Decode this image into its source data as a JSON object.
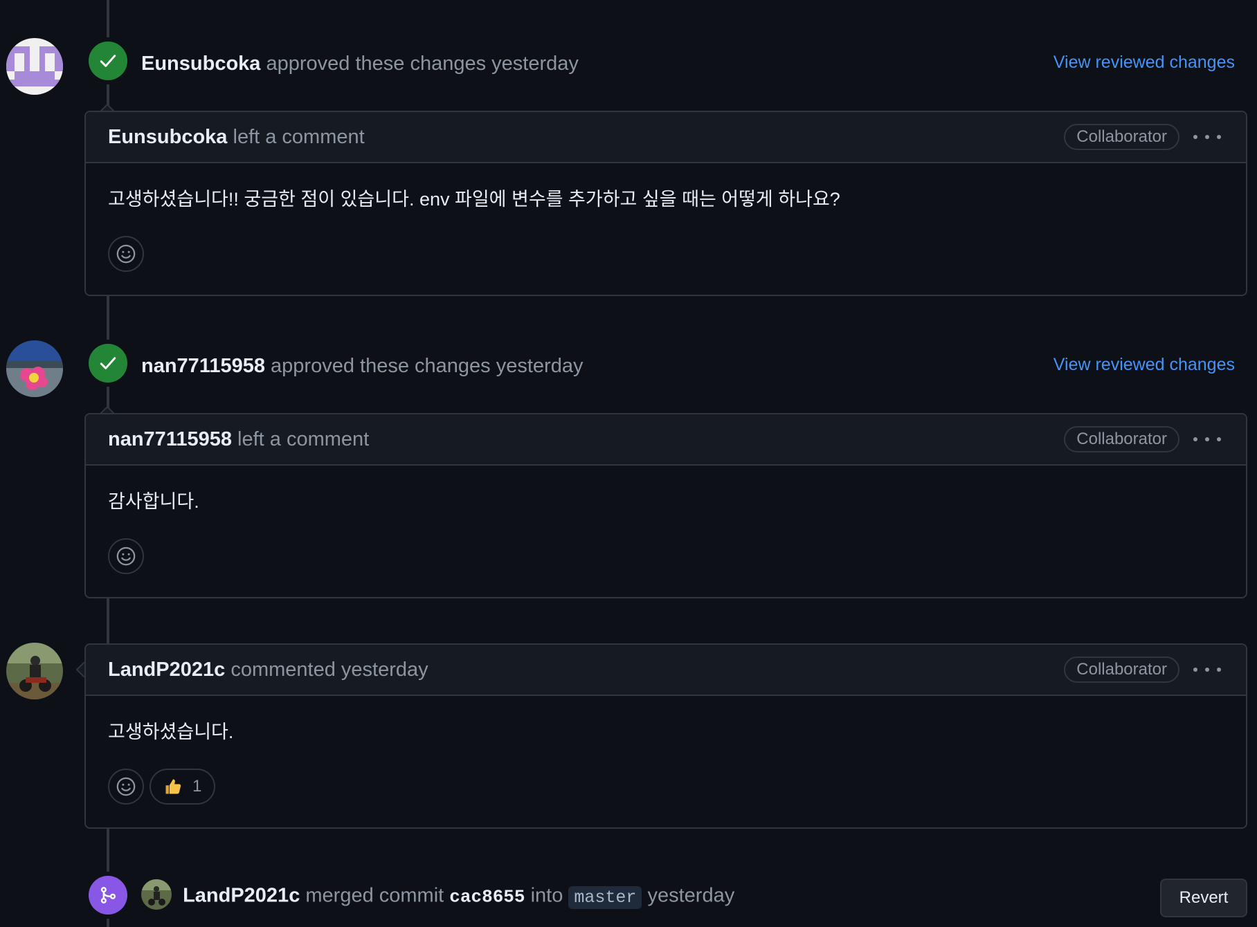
{
  "events": [
    {
      "type": "review",
      "author": "Eunsubcoka",
      "action": "approved these changes yesterday",
      "link": "View reviewed changes",
      "comment": {
        "author": "Eunsubcoka",
        "action": "left a comment",
        "role": "Collaborator",
        "body": "고생하셨습니다!! 궁금한 점이 있습니다. env 파일에 변수를 추가하고 싶을 때는 어떻게 하나요?"
      }
    },
    {
      "type": "review",
      "author": "nan77115958",
      "action": "approved these changes yesterday",
      "link": "View reviewed changes",
      "comment": {
        "author": "nan77115958",
        "action": "left a comment",
        "role": "Collaborator",
        "body": "감사합니다."
      }
    },
    {
      "type": "comment",
      "comment": {
        "author": "LandP2021c",
        "action": "commented yesterday",
        "role": "Collaborator",
        "body": "고생하셨습니다.",
        "reaction_count": "1",
        "reaction_icon": "thumbs-up"
      }
    },
    {
      "type": "merge",
      "author": "LandP2021c",
      "action_before": "merged commit",
      "commit": "cac8655",
      "into": "into",
      "branch": "master",
      "time": "yesterday",
      "button": "Revert"
    }
  ],
  "colors": {
    "background": "#0d1117",
    "approved": "#238636",
    "merged": "#8957e5",
    "link": "#4493f8"
  }
}
